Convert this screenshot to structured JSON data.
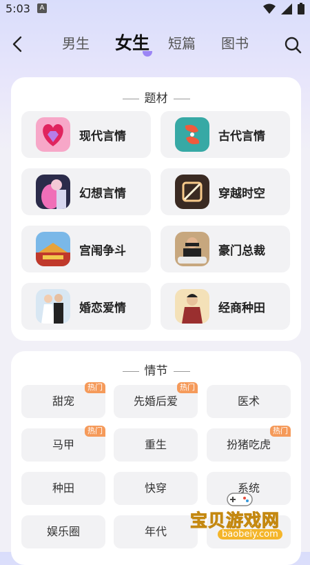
{
  "status_bar": {
    "time": "5:03",
    "notification_icon": "A"
  },
  "nav": {
    "tabs": [
      {
        "label": "男生"
      },
      {
        "label": "女生",
        "active": true
      },
      {
        "label": "短篇"
      },
      {
        "label": "图书"
      }
    ]
  },
  "topics": {
    "title": "题材",
    "items": [
      {
        "label": "现代言情",
        "icon": "heart-gem-icon"
      },
      {
        "label": "古代言情",
        "icon": "koi-fish-icon"
      },
      {
        "label": "幻想言情",
        "icon": "fantasy-couple-icon"
      },
      {
        "label": "穿越时空",
        "icon": "time-portal-icon"
      },
      {
        "label": "宫闱争斗",
        "icon": "palace-icon"
      },
      {
        "label": "豪门总裁",
        "icon": "ceo-car-icon"
      },
      {
        "label": "婚恋爱情",
        "icon": "wedding-couple-icon"
      },
      {
        "label": "经商种田",
        "icon": "merchant-icon"
      }
    ]
  },
  "plots": {
    "title": "情节",
    "items": [
      {
        "label": "甜宠",
        "badge": "热门"
      },
      {
        "label": "先婚后爱",
        "badge": "热门"
      },
      {
        "label": "医术"
      },
      {
        "label": "马甲",
        "badge": "热门"
      },
      {
        "label": "重生"
      },
      {
        "label": "扮猪吃虎",
        "badge": "热门"
      },
      {
        "label": "种田"
      },
      {
        "label": "快穿"
      },
      {
        "label": "系统"
      },
      {
        "label": "娱乐圈"
      },
      {
        "label": "年代"
      },
      {
        "label": ""
      }
    ]
  },
  "watermark": {
    "text": "宝贝游戏网",
    "url": "baobeiy.com"
  },
  "colors": {
    "accent": "#9b85f5",
    "badge": "#f59a5a"
  }
}
